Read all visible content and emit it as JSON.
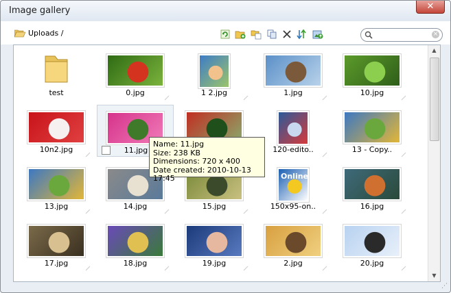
{
  "window": {
    "title": "Image gallery",
    "close_label": "✕"
  },
  "breadcrumb": {
    "path": "Uploads /"
  },
  "search": {
    "placeholder": "",
    "value": ""
  },
  "toolbar": {
    "icons": [
      "refresh-icon",
      "new-folder-icon",
      "paste-icon",
      "copy-icon",
      "delete-icon",
      "sort-icon",
      "upload-icon"
    ]
  },
  "items": [
    {
      "label": "test",
      "kind": "folder"
    },
    {
      "label": "0.jpg",
      "kind": "image",
      "colors": [
        "#2f6b14",
        "#d3331f",
        "#7bb33c"
      ]
    },
    {
      "label": "1 2.jpg",
      "kind": "image",
      "colors": [
        "#3d7cc7",
        "#f2c28c",
        "#9bc46a"
      ]
    },
    {
      "label": "1.jpg",
      "kind": "image",
      "colors": [
        "#5b90c8",
        "#7a5a3a",
        "#b8d2ea"
      ]
    },
    {
      "label": "10.jpg",
      "kind": "image",
      "colors": [
        "#5b9a2a",
        "#8ccf4e",
        "#2f5f1a"
      ]
    },
    {
      "label": "10n2.jpg",
      "kind": "image",
      "colors": [
        "#c8141a",
        "#f6f0f0",
        "#e04040"
      ]
    },
    {
      "label": "11.jpg",
      "kind": "image",
      "colors": [
        "#d6338a",
        "#3f7a2a",
        "#f07ab8"
      ],
      "selected": true
    },
    {
      "label": "",
      "kind": "image",
      "colors": [
        "#c12e22",
        "#1f4f1a",
        "#8aa86a"
      ]
    },
    {
      "label": "120-edito..",
      "kind": "image",
      "colors": [
        "#2c5a9a",
        "#c8d8ee",
        "#d63a3a"
      ]
    },
    {
      "label": "13 - Copy..",
      "kind": "image",
      "colors": [
        "#3d78c2",
        "#6aa83e",
        "#e2b637"
      ]
    },
    {
      "label": "13.jpg",
      "kind": "image",
      "colors": [
        "#3d78c2",
        "#6aa83e",
        "#e2b637"
      ]
    },
    {
      "label": "14.jpg",
      "kind": "image",
      "colors": [
        "#8a8a8a",
        "#e8e0d0",
        "#5a7a9a"
      ]
    },
    {
      "label": "15.jpg",
      "kind": "image",
      "colors": [
        "#7a8a3a",
        "#3a4a2a",
        "#c9c080"
      ]
    },
    {
      "label": "150x95-on..",
      "kind": "image",
      "colors": [
        "#1b5fb2",
        "#f3c820",
        "#ffffff"
      ],
      "text": "Online"
    },
    {
      "label": "16.jpg",
      "kind": "image",
      "colors": [
        "#3e6a7a",
        "#d07030",
        "#2a4a3a"
      ]
    },
    {
      "label": "17.jpg",
      "kind": "image",
      "colors": [
        "#7a6a4a",
        "#d8c090",
        "#3a3020"
      ]
    },
    {
      "label": "18.jpg",
      "kind": "image",
      "colors": [
        "#6a4ab8",
        "#e0c050",
        "#3a7a3a"
      ]
    },
    {
      "label": "19.jpg",
      "kind": "image",
      "colors": [
        "#1a3a7a",
        "#e6b8a0",
        "#5a7ac0"
      ]
    },
    {
      "label": "2.jpg",
      "kind": "image",
      "colors": [
        "#d8a040",
        "#6a4a2a",
        "#f0d080"
      ]
    },
    {
      "label": "20.jpg",
      "kind": "image",
      "colors": [
        "#b8d2f0",
        "#2a2a2a",
        "#e8f0fa"
      ]
    }
  ],
  "tooltip": {
    "name": "Name: 11.jpg",
    "size": "Size: 238 KB",
    "dimensions": "Dimensions: 720 x 400",
    "created": "Date created: 2010-10-13 17:45"
  },
  "scrollbar": {
    "up": "▲",
    "down": "▼"
  }
}
